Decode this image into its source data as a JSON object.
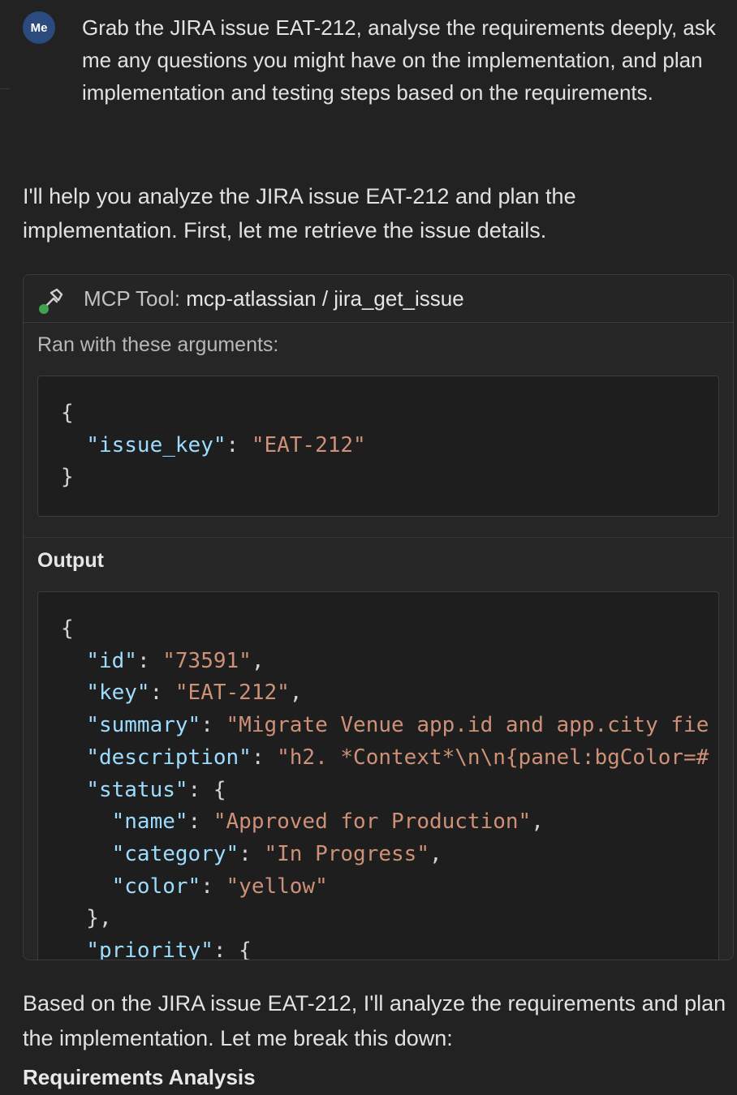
{
  "user": {
    "avatar_label": "Me",
    "message": "Grab the JIRA issue EAT-212, analyse the requirements deeply, ask me any questions you might have on the implementation, and plan implementation and testing steps based on the requirements."
  },
  "assistant": {
    "intro": "I'll help you analyze the JIRA issue EAT-212 and plan the implementation. First, let me retrieve the issue details.",
    "follow_up": "Based on the JIRA issue EAT-212, I'll analyze the requirements and plan the implementation. Let me break this down:",
    "heading": "Requirements Analysis"
  },
  "tool_call": {
    "label": "MCP Tool:",
    "name": "mcp-atlassian / jira_get_issue",
    "args_label": "Ran with these arguments:",
    "output_label": "Output",
    "icon": "wrench-icon",
    "status_color": "#3fa34d"
  },
  "args_lines": [
    [
      {
        "t": "{",
        "c": "p"
      }
    ],
    [
      {
        "t": "  ",
        "c": "p"
      },
      {
        "t": "\"issue_key\"",
        "c": "k"
      },
      {
        "t": ": ",
        "c": "p"
      },
      {
        "t": "\"EAT-212\"",
        "c": "s"
      }
    ],
    [
      {
        "t": "}",
        "c": "p"
      }
    ]
  ],
  "output_lines": [
    [
      {
        "t": "{",
        "c": "p"
      }
    ],
    [
      {
        "t": "  ",
        "c": "p"
      },
      {
        "t": "\"id\"",
        "c": "k"
      },
      {
        "t": ": ",
        "c": "p"
      },
      {
        "t": "\"73591\"",
        "c": "s"
      },
      {
        "t": ",",
        "c": "p"
      }
    ],
    [
      {
        "t": "  ",
        "c": "p"
      },
      {
        "t": "\"key\"",
        "c": "k"
      },
      {
        "t": ": ",
        "c": "p"
      },
      {
        "t": "\"EAT-212\"",
        "c": "s"
      },
      {
        "t": ",",
        "c": "p"
      }
    ],
    [
      {
        "t": "  ",
        "c": "p"
      },
      {
        "t": "\"summary\"",
        "c": "k"
      },
      {
        "t": ": ",
        "c": "p"
      },
      {
        "t": "\"Migrate Venue app.id and app.city fie",
        "c": "s"
      }
    ],
    [
      {
        "t": "  ",
        "c": "p"
      },
      {
        "t": "\"description\"",
        "c": "k"
      },
      {
        "t": ": ",
        "c": "p"
      },
      {
        "t": "\"h2. *Context*\\n\\n{panel:bgColor=#",
        "c": "s"
      }
    ],
    [
      {
        "t": "  ",
        "c": "p"
      },
      {
        "t": "\"status\"",
        "c": "k"
      },
      {
        "t": ": {",
        "c": "p"
      }
    ],
    [
      {
        "t": "    ",
        "c": "p"
      },
      {
        "t": "\"name\"",
        "c": "k"
      },
      {
        "t": ": ",
        "c": "p"
      },
      {
        "t": "\"Approved for Production\"",
        "c": "s"
      },
      {
        "t": ",",
        "c": "p"
      }
    ],
    [
      {
        "t": "    ",
        "c": "p"
      },
      {
        "t": "\"category\"",
        "c": "k"
      },
      {
        "t": ": ",
        "c": "p"
      },
      {
        "t": "\"In Progress\"",
        "c": "s"
      },
      {
        "t": ",",
        "c": "p"
      }
    ],
    [
      {
        "t": "    ",
        "c": "p"
      },
      {
        "t": "\"color\"",
        "c": "k"
      },
      {
        "t": ": ",
        "c": "p"
      },
      {
        "t": "\"yellow\"",
        "c": "s"
      }
    ],
    [
      {
        "t": "  },",
        "c": "p"
      }
    ],
    [
      {
        "t": "  ",
        "c": "p"
      },
      {
        "t": "\"priority\"",
        "c": "k"
      },
      {
        "t": ": {",
        "c": "p"
      }
    ]
  ],
  "colors": {
    "background": "#222223",
    "code_key": "#9cdcfe",
    "code_string": "#ce9178",
    "avatar": "#2b4a7e"
  }
}
